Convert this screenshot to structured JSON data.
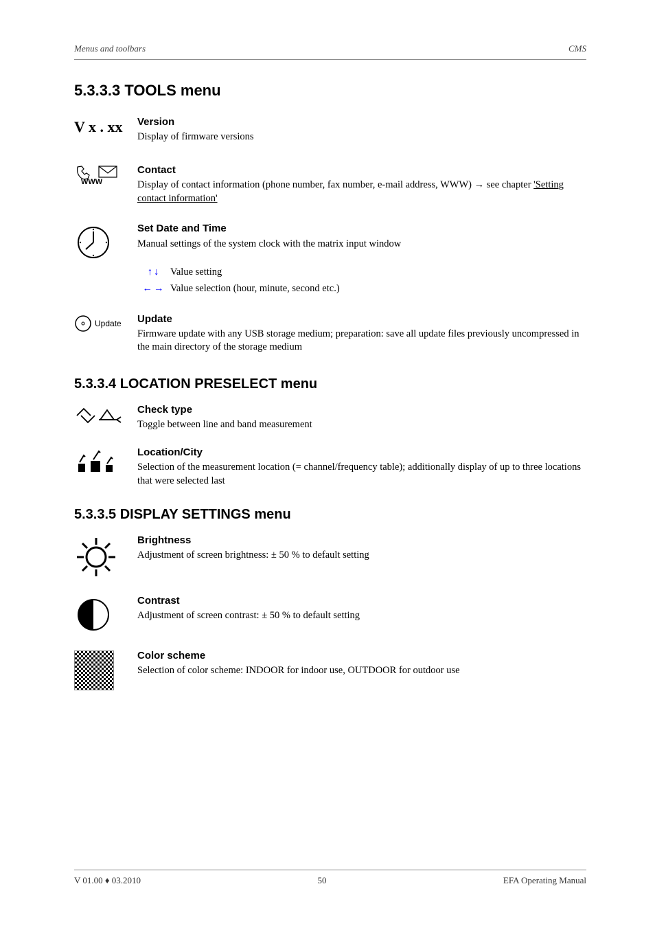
{
  "header": {
    "left": "Menus and toolbars",
    "right": "CMS"
  },
  "chapter": "5.3.3.3 TOOLS menu",
  "entries": [
    {
      "title": "Version",
      "text": "Display of firmware versions"
    },
    {
      "title": "Contact",
      "text": "Display of contact information (phone number, fax number, e-mail address, WWW) → see chapter ",
      "link": "'Setting contact information'"
    },
    {
      "title": "Set Date and Time",
      "text": "Manual settings of the system clock with the matrix input window"
    }
  ],
  "date_line1": {
    "arrows": "↑↓",
    "text": "Value setting"
  },
  "date_line2": {
    "arrows": "←→",
    "text": "Value selection (hour, minute, second etc.)"
  },
  "update": {
    "title": "Update",
    "text": "Firmware update with any USB storage medium; preparation: save all update files previously uncompressed in the main directory of the storage medium"
  },
  "section_heads": {
    "a": "5.3.3.4 LOCATION PRESELECT menu",
    "b": "5.3.3.5 DISPLAY SETTINGS menu"
  },
  "location": [
    {
      "title": "Check type",
      "text": "Toggle between line and band measurement"
    },
    {
      "title": "Location/City",
      "text": "Selection of the measurement location (= channel/frequency table); additionally display of up to three locations that were selected last"
    }
  ],
  "display": [
    {
      "title": "Brightness",
      "text": "Adjustment of screen brightness: ± 50 % to default setting"
    },
    {
      "title": "Contrast",
      "text": "Adjustment of screen contrast: ± 50 % to default setting"
    },
    {
      "title": "Color scheme",
      "text": "Selection of color scheme: INDOOR for indoor use, OUTDOOR for outdoor use"
    }
  ],
  "footer": {
    "left": "V 01.00 ♦ 03.2010",
    "center": "50",
    "right": "EFA Operating Manual"
  }
}
